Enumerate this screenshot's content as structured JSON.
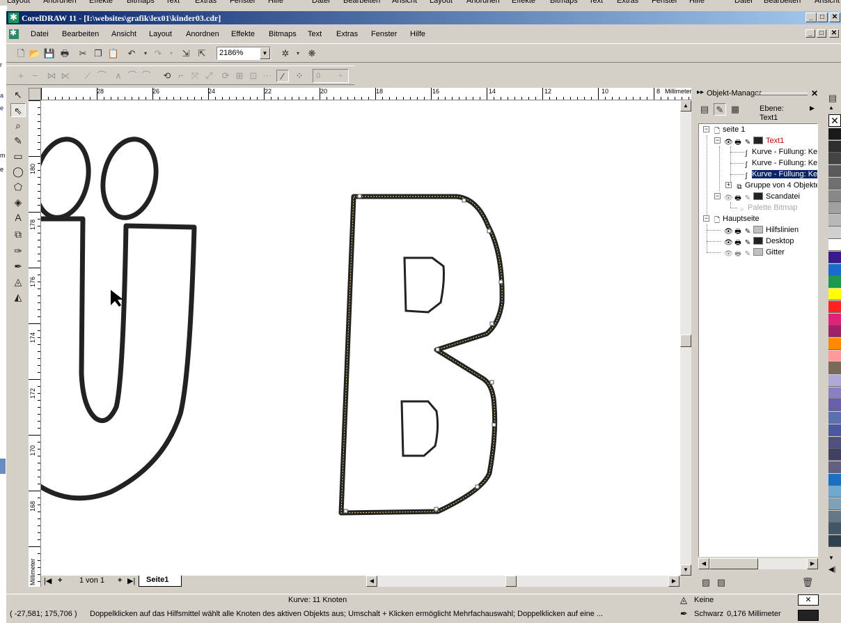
{
  "background_menu": [
    "Layout",
    "Anordnen",
    "Effekte",
    "Bitmaps",
    "Text",
    "Extras",
    "Fenster",
    "Hilfe",
    "Datei",
    "Bearbeiten",
    "Ansicht",
    "Layout",
    "Anordnen",
    "Effekte",
    "Bitmaps",
    "Text",
    "Extras",
    "Fenster",
    "Hilfe",
    "Datei",
    "Bearbeiten",
    "Ansicht"
  ],
  "window": {
    "title": "CorelDRAW 11 - [I:\\websites\\grafik\\lex01\\kinder03.cdr]",
    "controls": [
      "_",
      "□",
      "✕"
    ]
  },
  "menu": [
    "Datei",
    "Bearbeiten",
    "Ansicht",
    "Layout",
    "Anordnen",
    "Effekte",
    "Bitmaps",
    "Text",
    "Extras",
    "Fenster",
    "Hilfe"
  ],
  "toolbar": {
    "zoom": "2186%",
    "nodes_count_field": "0"
  },
  "ruler": {
    "unit": "Millimeter",
    "h_labels": [
      "28",
      "26",
      "24",
      "22",
      "20",
      "18",
      "16",
      "14",
      "12",
      "10",
      "8"
    ],
    "v_labels": [
      "180",
      "178",
      "176",
      "174",
      "172",
      "170",
      "168"
    ]
  },
  "page_nav": {
    "page_of": "1 von 1",
    "tab": "Seite1"
  },
  "docker": {
    "title": "Objekt-Manager",
    "ebene_label": "Ebene:",
    "ebene_value": "Text1",
    "tree": [
      {
        "label": "seite 1",
        "level": 0
      },
      {
        "label": "Text1",
        "level": 1,
        "color": "#cc0000",
        "swatch": "#222222"
      },
      {
        "label": "Kurve - Füllung: Keine",
        "level": 2
      },
      {
        "label": "Kurve - Füllung: Keine",
        "level": 2
      },
      {
        "label": "Kurve - Füllung: Keine",
        "level": 2,
        "selected": true
      },
      {
        "label": "Gruppe von 4 Objekten",
        "level": 2
      },
      {
        "label": "Scandatei",
        "level": 1,
        "swatch": "#222222"
      },
      {
        "label": "Palette Bitmap",
        "level": 2,
        "disabled": true
      },
      {
        "label": "Hauptseite",
        "level": 0
      },
      {
        "label": "Hilfslinien",
        "level": 1,
        "swatch": "#c0c0c0"
      },
      {
        "label": "Desktop",
        "level": 1,
        "swatch": "#222222"
      },
      {
        "label": "Gitter",
        "level": 1,
        "swatch": "#c0c0c0"
      }
    ]
  },
  "palette": [
    "#1a1a1a",
    "#2e2e2e",
    "#444444",
    "#5a5a5a",
    "#707070",
    "#888888",
    "#a0a0a0",
    "#b8b8b8",
    "#d0d0d0",
    "#ffffff",
    "#3a1a8a",
    "#1a6ad0",
    "#1a9a4a",
    "#ffff00",
    "#ff2020",
    "#e0207a",
    "#a0206a",
    "#ff8a00",
    "#ff9a9a",
    "#7a6a5a",
    "#b0a8d8",
    "#8a80c0",
    "#6a60a8",
    "#5a70b0",
    "#4a58a0",
    "#505080",
    "#404060",
    "#606080",
    "#1a70c0",
    "#70a8d0",
    "#80a0b8",
    "#607888",
    "#405868",
    "#304050"
  ],
  "status": {
    "curve_info": "Kurve: 11 Knoten",
    "coords": "( -27,581; 175,706 )",
    "hint": "Doppelklicken auf das Hilfsmittel wählt alle Knoten des aktiven Objekts aus; Umschalt + Klicken ermöglicht Mehrfachauswahl; Doppelklicken auf eine ...",
    "fill_label": "Keine",
    "outline_label": "Schwarz",
    "outline_width": "0,176 Millimeter"
  }
}
